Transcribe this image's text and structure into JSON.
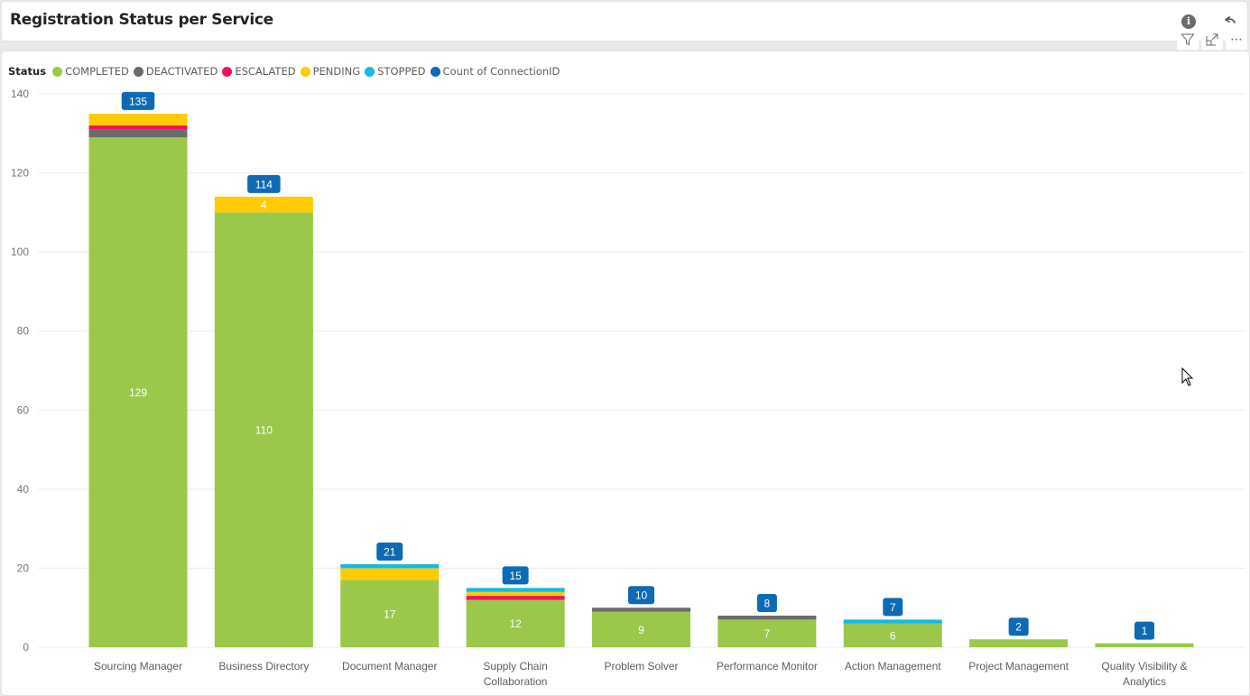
{
  "header": {
    "title": "Registration Status per Service",
    "icons": [
      "info-icon",
      "undo-icon",
      "filter-icon",
      "focus-mode-icon",
      "more-options-icon"
    ],
    "more_label": "⋯"
  },
  "legend": {
    "title": "Status",
    "items": [
      {
        "label": "COMPLETED",
        "color": "#9BC84B"
      },
      {
        "label": "DEACTIVATED",
        "color": "#6B6B6B"
      },
      {
        "label": "ESCALATED",
        "color": "#F0115F"
      },
      {
        "label": "PENDING",
        "color": "#FECC00"
      },
      {
        "label": "STOPPED",
        "color": "#13BAE8"
      },
      {
        "label": "Count of ConnectionID",
        "color": "#0E6AB5"
      }
    ]
  },
  "chart_data": {
    "type": "bar",
    "stacked": true,
    "title": "Registration Status per Service",
    "xlabel": "",
    "ylabel": "",
    "ylim": [
      0,
      140
    ],
    "yticks": [
      0,
      20,
      40,
      60,
      80,
      100,
      120,
      140
    ],
    "grid": true,
    "legend_position": "top-left",
    "categories": [
      [
        "Sourcing Manager"
      ],
      [
        "Business Directory"
      ],
      [
        "Document Manager"
      ],
      [
        "Supply Chain",
        "Collaboration"
      ],
      [
        "Problem Solver"
      ],
      [
        "Performance Monitor"
      ],
      [
        "Action Management"
      ],
      [
        "Project Management"
      ],
      [
        "Quality Visibility &",
        "Analytics"
      ]
    ],
    "series": [
      {
        "name": "COMPLETED",
        "color": "#9BC84B",
        "values": [
          129,
          110,
          17,
          12,
          9,
          7,
          6,
          2,
          1
        ],
        "show_labels": [
          true,
          true,
          true,
          true,
          true,
          true,
          true,
          false,
          false
        ]
      },
      {
        "name": "DEACTIVATED",
        "color": "#6B6B6B",
        "values": [
          2,
          0,
          0,
          0,
          1,
          1,
          0,
          0,
          0
        ],
        "show_labels": [
          false,
          false,
          false,
          false,
          false,
          false,
          false,
          false,
          false
        ]
      },
      {
        "name": "ESCALATED",
        "color": "#F0115F",
        "values": [
          1,
          0,
          0,
          1,
          0,
          0,
          0,
          0,
          0
        ],
        "show_labels": [
          false,
          false,
          false,
          false,
          false,
          false,
          false,
          false,
          false
        ]
      },
      {
        "name": "PENDING",
        "color": "#FECC00",
        "values": [
          3,
          4,
          3,
          1,
          0,
          0,
          0,
          0,
          0
        ],
        "show_labels": [
          false,
          true,
          false,
          false,
          false,
          false,
          false,
          false,
          false
        ]
      },
      {
        "name": "STOPPED",
        "color": "#13BAE8",
        "values": [
          0,
          0,
          1,
          1,
          0,
          0,
          1,
          0,
          0
        ],
        "show_labels": [
          false,
          false,
          false,
          false,
          false,
          false,
          false,
          false,
          false
        ]
      }
    ],
    "totals": {
      "name": "Count of ConnectionID",
      "color": "#0E6AB5",
      "values": [
        135,
        114,
        21,
        15,
        10,
        8,
        7,
        2,
        1
      ]
    }
  }
}
